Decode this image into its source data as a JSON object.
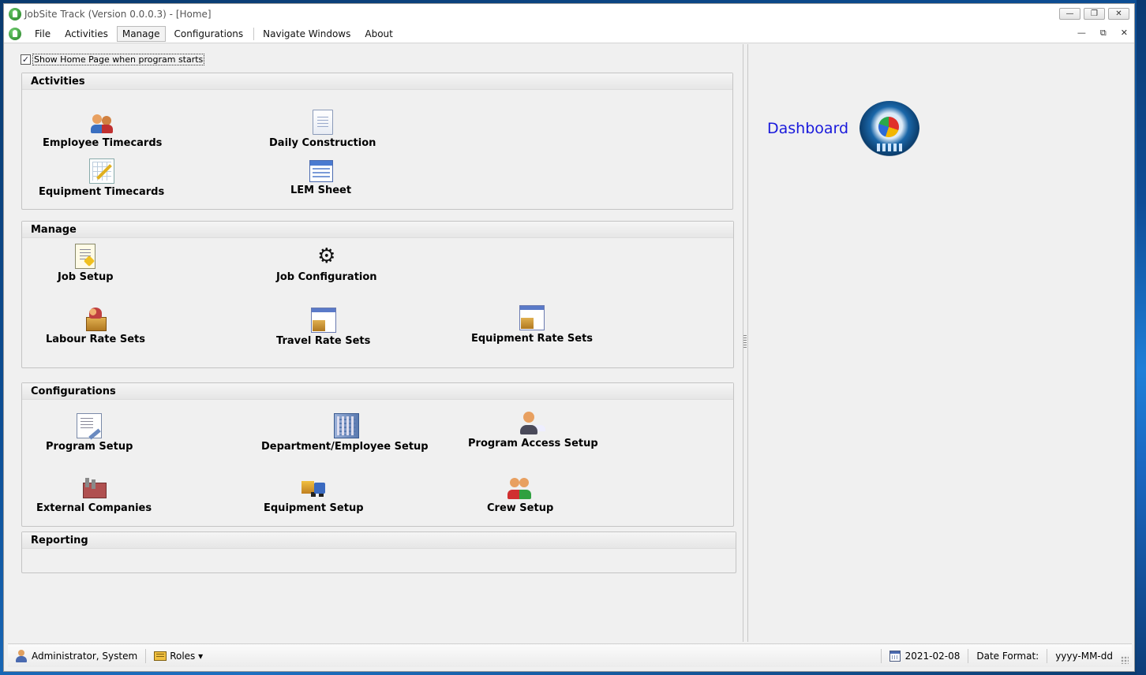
{
  "window": {
    "title": "JobSite Track (Version 0.0.0.3) - [Home]",
    "controls": {
      "minimize": "—",
      "maximize": "❐",
      "close": "✕"
    }
  },
  "menu": {
    "items": [
      "File",
      "Activities",
      "Manage",
      "Configurations",
      "Navigate Windows",
      "About"
    ],
    "active": "Manage",
    "mdi_controls": {
      "minimize": "—",
      "restore": "⧉",
      "close": "✕"
    }
  },
  "home": {
    "show_home_checkbox": {
      "label": "Show Home Page when program starts",
      "checked": true,
      "mark": "✓"
    },
    "groups": {
      "activities": {
        "title": "Activities",
        "items": [
          {
            "label": "Employee Timecards",
            "icon": "people-card-icon"
          },
          {
            "label": "Daily Construction",
            "icon": "document-icon"
          },
          {
            "label": "Equipment Timecards",
            "icon": "chart-pencil-icon"
          },
          {
            "label": "LEM Sheet",
            "icon": "table-icon"
          }
        ]
      },
      "manage": {
        "title": "Manage",
        "items": [
          {
            "label": "Job Setup",
            "icon": "note-edit-icon"
          },
          {
            "label": "Job Configuration",
            "icon": "gear-icon"
          },
          {
            "label": "Labour Rate Sets",
            "icon": "people-box-icon"
          },
          {
            "label": "Travel Rate Sets",
            "icon": "window-box-icon"
          },
          {
            "label": "Equipment Rate Sets",
            "icon": "star-box-icon"
          }
        ]
      },
      "configurations": {
        "title": "Configurations",
        "items": [
          {
            "label": "Program Setup",
            "icon": "tools-document-icon"
          },
          {
            "label": "Department/Employee Setup",
            "icon": "building-icon"
          },
          {
            "label": "Program Access Setup",
            "icon": "person-card-icon"
          },
          {
            "label": "External Companies",
            "icon": "factory-icon"
          },
          {
            "label": "Equipment Setup",
            "icon": "truck-icon"
          },
          {
            "label": "Crew Setup",
            "icon": "crew-icon"
          }
        ]
      },
      "reporting": {
        "title": "Reporting"
      }
    }
  },
  "dashboard": {
    "label": "Dashboard",
    "icon": "dashboard-pie-globe-icon"
  },
  "status": {
    "user": "Administrator, System",
    "roles": "Roles ▾",
    "date": "2021-02-08",
    "date_format_label": "Date Format:",
    "date_format_value": "yyyy-MM-dd"
  }
}
